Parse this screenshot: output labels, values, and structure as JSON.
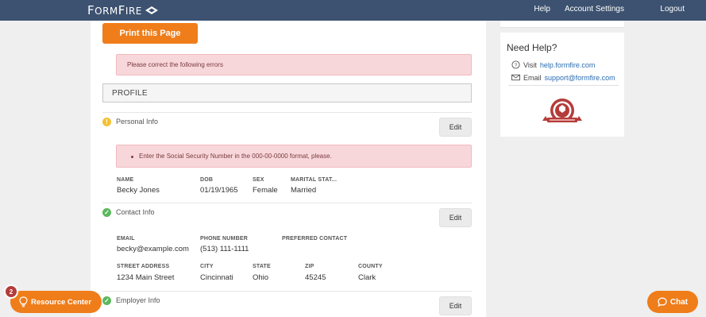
{
  "brand": {
    "name_big": "F",
    "name_rest": "ORM",
    "name_big2": "F",
    "name_rest2": "IRE",
    "tm": "™"
  },
  "nav": {
    "help": "Help",
    "account_settings": "Account Settings",
    "logout": "Logout"
  },
  "actions": {
    "print": "Print this Page"
  },
  "errors": {
    "banner": "Please correct the following errors",
    "ssn": "Enter the Social Security Number in the 000-00-0000 format, please."
  },
  "profile": {
    "title": "PROFILE",
    "sections": [
      {
        "title": "Personal Info",
        "status": "warning",
        "edit": "Edit"
      },
      {
        "title": "Contact Info",
        "status": "complete",
        "edit": "Edit"
      },
      {
        "title": "Employer Info",
        "status": "complete",
        "edit": "Edit"
      }
    ],
    "personal": {
      "name_label": "NAME",
      "name": "Becky Jones",
      "dob_label": "DOB",
      "dob": "01/19/1965",
      "sex_label": "SEX",
      "sex": "Female",
      "marital_label": "MARITAL STAT...",
      "marital": "Married"
    },
    "contact": {
      "email_label": "EMAIL",
      "email": "becky@example.com",
      "phone_label": "PHONE NUMBER",
      "phone": "(513) 111-1111",
      "pref_label": "PREFERRED CONTACT",
      "street_label": "STREET ADDRESS",
      "street": "1234 Main Street",
      "city_label": "CITY",
      "city": "Cincinnati",
      "state_label": "STATE",
      "state": "Ohio",
      "zip_label": "ZIP",
      "zip": "45245",
      "county_label": "COUNTY",
      "county": "Clark"
    }
  },
  "help": {
    "title": "Need Help?",
    "visit_prefix": "Visit",
    "visit_link": "help.formfire.com",
    "email_prefix": "Email",
    "email_link": "support@formfire.com"
  },
  "widgets": {
    "resource_center": "Resource Center",
    "resource_badge": "2",
    "chat": "Chat"
  },
  "colors": {
    "topbar": "#3c5270",
    "accent": "#ef7d1a",
    "error_bg": "#f8d7da",
    "warning": "#f1c232",
    "success": "#5cb85c",
    "link": "#2b6cb0"
  }
}
